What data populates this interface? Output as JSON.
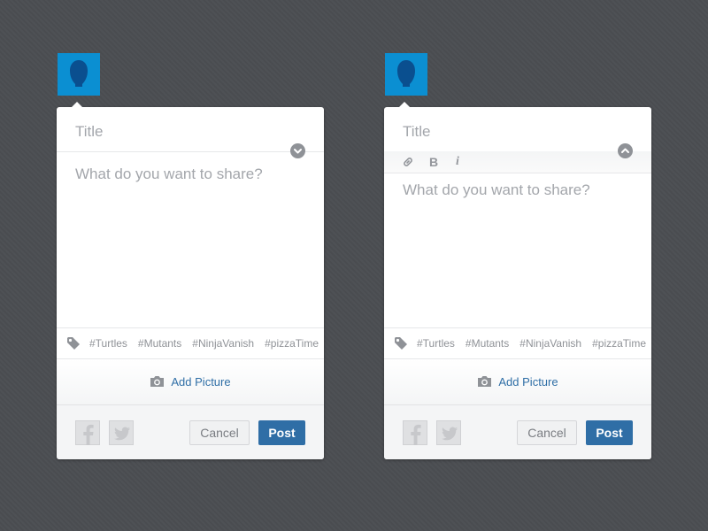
{
  "colors": {
    "background": "#4b4e52",
    "avatar": "#0b8fd2",
    "avatar_silhouette": "#0a4f8f",
    "accent": "#2f6ea6",
    "placeholder_text": "#a3a6ab"
  },
  "composers": [
    {
      "variant": "collapsed",
      "avatar_icon": "user-silhouette-icon",
      "title_placeholder": "Title",
      "format_toggle_icon": "chevron-down-icon",
      "body_placeholder": "What do you want to share?",
      "tags_icon": "tag-icon",
      "tags": [
        "#Turtles",
        "#Mutants",
        "#NinjaVanish",
        "#pizzaTime"
      ],
      "add_picture_icon": "camera-icon",
      "add_picture_label": "Add Picture",
      "social_icons": [
        "facebook-icon",
        "twitter-icon"
      ],
      "cancel_label": "Cancel",
      "post_label": "Post"
    },
    {
      "variant": "expanded",
      "avatar_icon": "user-silhouette-icon",
      "title_placeholder": "Title",
      "format_toggle_icon": "chevron-up-icon",
      "format_tools": {
        "link_icon": "link-icon",
        "bold_label": "B",
        "italic_label": "i"
      },
      "body_placeholder": "What do you want to share?",
      "tags_icon": "tag-icon",
      "tags": [
        "#Turtles",
        "#Mutants",
        "#NinjaVanish",
        "#pizzaTime"
      ],
      "add_picture_icon": "camera-icon",
      "add_picture_label": "Add Picture",
      "social_icons": [
        "facebook-icon",
        "twitter-icon"
      ],
      "cancel_label": "Cancel",
      "post_label": "Post"
    }
  ]
}
